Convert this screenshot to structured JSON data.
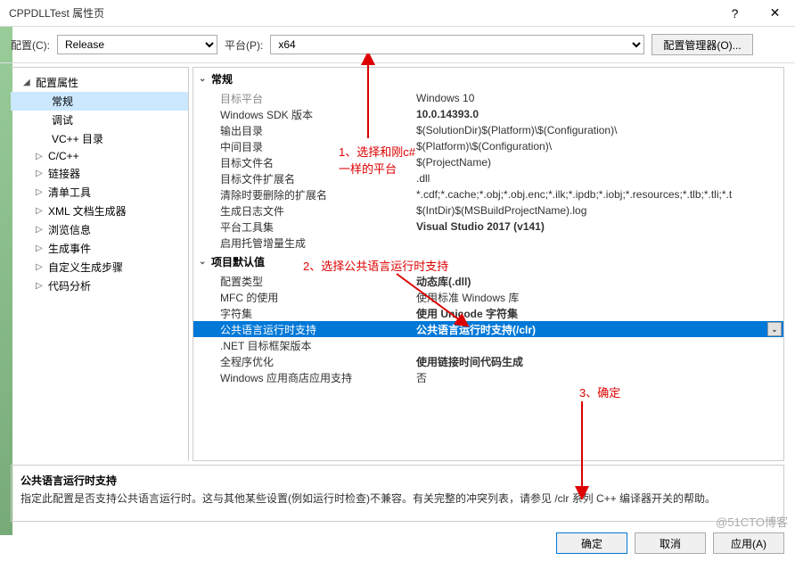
{
  "title": "CPPDLLTest 属性页",
  "toolbar": {
    "config_label": "配置(C):",
    "config_value": "Release",
    "platform_label": "平台(P):",
    "platform_value": "x64",
    "mgr_label": "配置管理器(O)..."
  },
  "tree": {
    "root": "配置属性",
    "items": [
      "常规",
      "调试",
      "VC++ 目录",
      "C/C++",
      "链接器",
      "清单工具",
      "XML 文档生成器",
      "浏览信息",
      "生成事件",
      "自定义生成步骤",
      "代码分析"
    ]
  },
  "sections": {
    "general": "常规",
    "defaults": "项目默认值"
  },
  "props_general": [
    {
      "label": "目标平台",
      "value": "Windows 10",
      "dim": true
    },
    {
      "label": "Windows SDK 版本",
      "value": "10.0.14393.0",
      "bold": true
    },
    {
      "label": "输出目录",
      "value": "$(SolutionDir)$(Platform)\\$(Configuration)\\"
    },
    {
      "label": "中间目录",
      "value": "$(Platform)\\$(Configuration)\\"
    },
    {
      "label": "目标文件名",
      "value": "$(ProjectName)"
    },
    {
      "label": "目标文件扩展名",
      "value": ".dll"
    },
    {
      "label": "清除时要删除的扩展名",
      "value": "*.cdf;*.cache;*.obj;*.obj.enc;*.ilk;*.ipdb;*.iobj;*.resources;*.tlb;*.tli;*.t"
    },
    {
      "label": "生成日志文件",
      "value": "$(IntDir)$(MSBuildProjectName).log"
    },
    {
      "label": "平台工具集",
      "value": "Visual Studio 2017 (v141)",
      "bold": true
    },
    {
      "label": "启用托管增量生成",
      "value": ""
    }
  ],
  "props_defaults": [
    {
      "label": "配置类型",
      "value": "动态库(.dll)",
      "bold": true
    },
    {
      "label": "MFC 的使用",
      "value": "使用标准 Windows 库"
    },
    {
      "label": "字符集",
      "value": "使用 Unicode 字符集",
      "bold": true
    },
    {
      "label": "公共语言运行时支持",
      "value": "公共语言运行时支持(/clr)",
      "bold": true,
      "selected": true
    },
    {
      "label": ".NET 目标框架版本",
      "value": ""
    },
    {
      "label": "全程序优化",
      "value": "使用链接时间代码生成",
      "bold": true
    },
    {
      "label": "Windows 应用商店应用支持",
      "value": "否"
    }
  ],
  "desc": {
    "title": "公共语言运行时支持",
    "text": "指定此配置是否支持公共语言运行时。这与其他某些设置(例如运行时检查)不兼容。有关完整的冲突列表，请参见 /clr 系列 C++ 编译器开关的帮助。"
  },
  "footer": {
    "ok": "确定",
    "cancel": "取消",
    "apply": "应用(A)"
  },
  "annots": {
    "a1": "1、选择和刚c#\n一样的平台",
    "a2": "2、选择公共语言运行时支持",
    "a3": "3、确定"
  },
  "watermark": "@51CTO博客"
}
